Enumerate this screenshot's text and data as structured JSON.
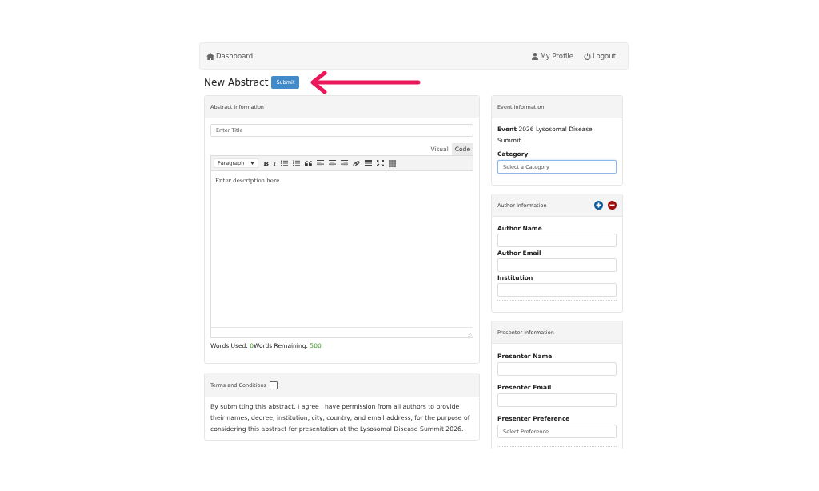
{
  "navbar": {
    "home": "Dashboard",
    "links": [
      "My Profile",
      "Logout"
    ]
  },
  "page": {
    "title": "New Abstract",
    "submit": "Submit"
  },
  "abstract_panel": {
    "title": "Abstract Information",
    "title_field": {
      "placeholder": "Enter Title"
    },
    "editor_tabs": [
      {
        "label": "Visual",
        "selected": true
      },
      {
        "label": "Code",
        "selected": false
      }
    ],
    "format_dropdown": "Paragraph",
    "bold_glyph": "B",
    "italic_glyph": "I",
    "description": {
      "placeholder": "Enter description here."
    },
    "words_used_label": "Words Used: ",
    "words_used": "0",
    "words_remaining_label": "Words Remaining: ",
    "words_remaining": "500"
  },
  "terms_panel": {
    "title": "Terms and Conditions",
    "checked": false,
    "text": "By submitting this abstract, I agree I have permission from all authors to provide their names, degree, institution, city, country, and email address, for the purpose of considering this abstract for presentation at the Lysosomal Disease Summit 2026."
  },
  "event_panel": {
    "title": "Event Information",
    "event_label": "Event",
    "event_name": "2026 Lysosomal Disease Summit",
    "category_label": "Category",
    "category": {
      "placeholder": "Select a Category"
    }
  },
  "author_panel": {
    "title": "Author Information",
    "fields": [
      {
        "label": "Author Name"
      },
      {
        "label": "Author Email"
      },
      {
        "label": "Institution"
      }
    ]
  },
  "presenter_panel": {
    "title": "Presenter Information",
    "fields": [
      {
        "label": "Presenter Name",
        "kind": "input"
      },
      {
        "label": "Presenter Email",
        "kind": "input"
      },
      {
        "label": "Presenter Preference",
        "kind": "select",
        "placeholder": "Select Preference"
      }
    ]
  }
}
